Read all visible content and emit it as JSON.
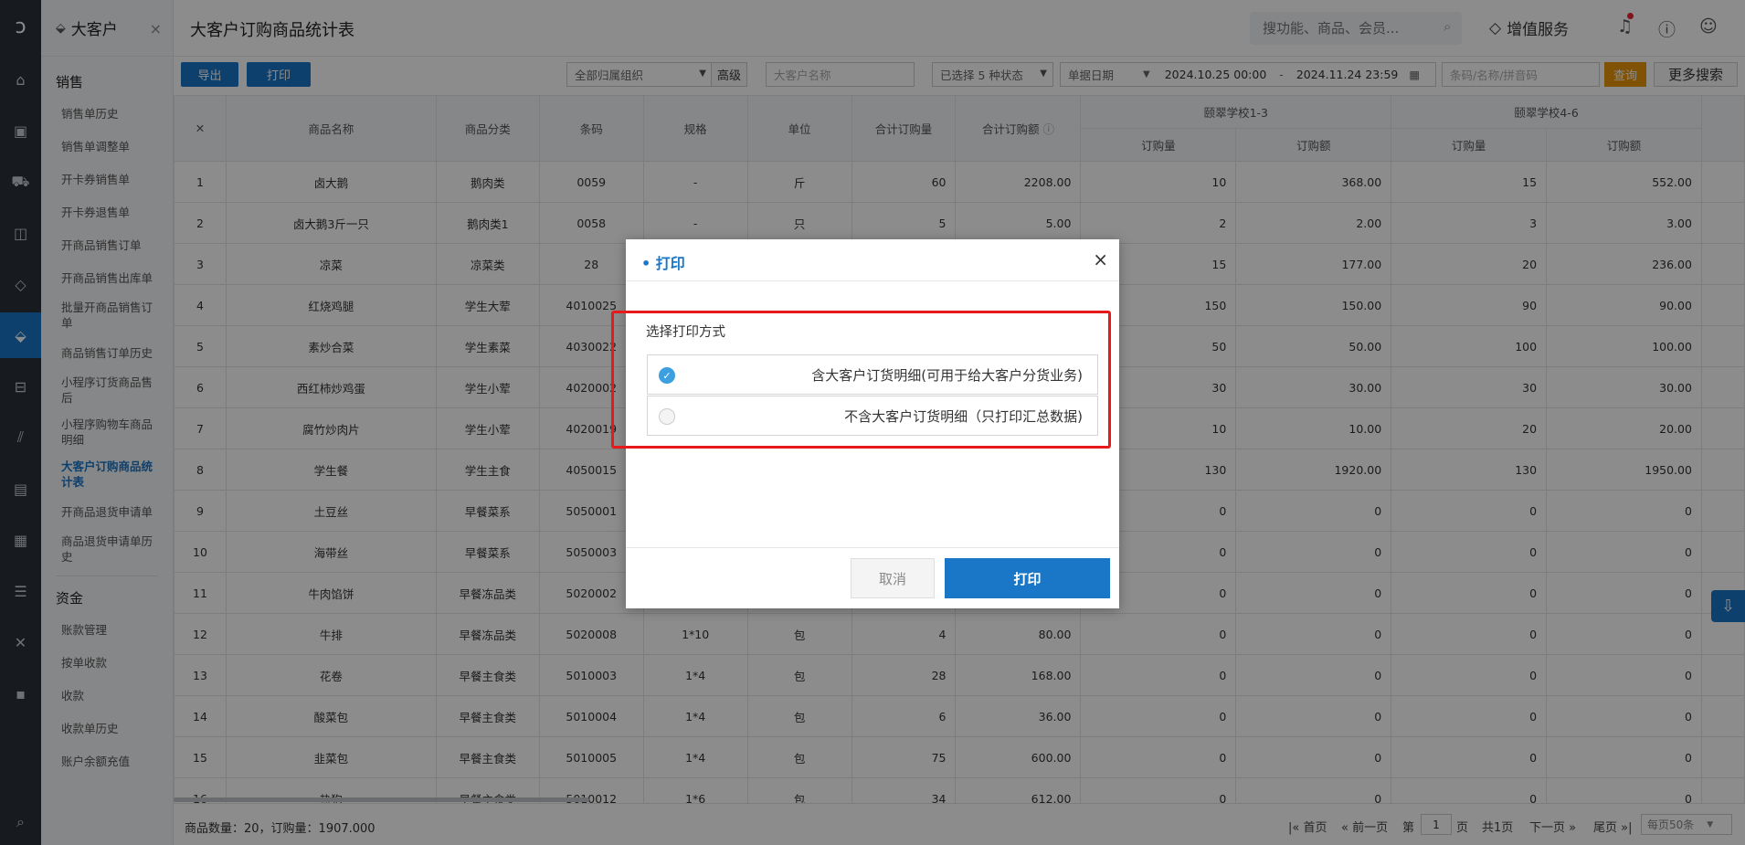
{
  "nav": {
    "title": "大客户",
    "close": "×",
    "sections": [
      {
        "name": "销售",
        "items": [
          "销售单历史",
          "销售单调整单",
          "开卡券销售单",
          "开卡券退售单",
          "开商品销售订单",
          "开商品销售出库单",
          "批量开商品销售订单",
          "商品销售订单历史",
          "小程序订货商品售后",
          "小程序购物车商品明细",
          "大客户订购商品统计表",
          "开商品退货申请单",
          "商品退货申请单历史"
        ]
      },
      {
        "name": "资金",
        "items": [
          "账款管理",
          "按单收款",
          "收款",
          "收款单历史",
          "账户余额充值"
        ]
      }
    ],
    "current": "大客户订购商品统计表"
  },
  "header": {
    "title": "大客户订购商品统计表",
    "search_placeholder": "搜功能、商品、会员...",
    "value_service": "增值服务"
  },
  "toolbar": {
    "export": "导出",
    "print": "打印",
    "org_select": "全部归属组织",
    "advanced": "高级",
    "customer_placeholder": "大客户名称",
    "status_select": "已选择 5 种状态",
    "date_type": "单据日期",
    "date_from": "2024.10.25 00:00",
    "date_sep": "-",
    "date_to": "2024.11.24 23:59",
    "code_placeholder": "条码/名称/拼音码",
    "query": "查询",
    "more": "更多搜索"
  },
  "table": {
    "headers": [
      "商品名称",
      "商品分类",
      "条码",
      "规格",
      "单位",
      "合计订购量",
      "合计订购额"
    ],
    "groups": [
      "颐翠学校1-3",
      "颐翠学校4-6"
    ],
    "sub_headers": [
      "订购量",
      "订购额"
    ],
    "rows": [
      [
        "1",
        "卤大鹅",
        "鹅肉类",
        "0059",
        "-",
        "斤",
        "60",
        "2208.00",
        "10",
        "368.00",
        "15",
        "552.00"
      ],
      [
        "2",
        "卤大鹅3斤一只",
        "鹅肉类1",
        "0058",
        "-",
        "只",
        "5",
        "5.00",
        "2",
        "2.00",
        "3",
        "3.00"
      ],
      [
        "3",
        "凉菜",
        "凉菜类",
        "28",
        "",
        "",
        "",
        "",
        "15",
        "177.00",
        "20",
        "236.00"
      ],
      [
        "4",
        "红烧鸡腿",
        "学生大荤",
        "4010025",
        "",
        "",
        "",
        "",
        "150",
        "150.00",
        "90",
        "90.00"
      ],
      [
        "5",
        "素炒合菜",
        "学生素菜",
        "4030022",
        "",
        "",
        "",
        "",
        "50",
        "50.00",
        "100",
        "100.00"
      ],
      [
        "6",
        "西红柿炒鸡蛋",
        "学生小荤",
        "4020002",
        "",
        "",
        "",
        "",
        "30",
        "30.00",
        "30",
        "30.00"
      ],
      [
        "7",
        "腐竹炒肉片",
        "学生小荤",
        "4020019",
        "",
        "",
        "",
        "",
        "10",
        "10.00",
        "20",
        "20.00"
      ],
      [
        "8",
        "学生餐",
        "学生主食",
        "4050015",
        "",
        "",
        "",
        "",
        "130",
        "1920.00",
        "130",
        "1950.00"
      ],
      [
        "9",
        "土豆丝",
        "早餐菜系",
        "5050001",
        "",
        "",
        "",
        "",
        "0",
        "0",
        "0",
        "0"
      ],
      [
        "10",
        "海带丝",
        "早餐菜系",
        "5050003",
        "",
        "",
        "",
        "",
        "0",
        "0",
        "0",
        "0"
      ],
      [
        "11",
        "牛肉馅饼",
        "早餐冻品类",
        "5020002",
        "",
        "",
        "",
        "",
        "0",
        "0",
        "0",
        "0"
      ],
      [
        "12",
        "牛排",
        "早餐冻品类",
        "5020008",
        "1*10",
        "包",
        "4",
        "80.00",
        "0",
        "0",
        "0",
        "0"
      ],
      [
        "13",
        "花卷",
        "早餐主食类",
        "5010003",
        "1*4",
        "包",
        "28",
        "168.00",
        "0",
        "0",
        "0",
        "0"
      ],
      [
        "14",
        "酸菜包",
        "早餐主食类",
        "5010004",
        "1*4",
        "包",
        "6",
        "36.00",
        "0",
        "0",
        "0",
        "0"
      ],
      [
        "15",
        "韭菜包",
        "早餐主食类",
        "5010005",
        "1*4",
        "包",
        "75",
        "600.00",
        "0",
        "0",
        "0",
        "0"
      ],
      [
        "16",
        "热狗",
        "早餐主食类",
        "5010012",
        "1*6",
        "包",
        "34",
        "612.00",
        "0",
        "0",
        "0",
        "0"
      ]
    ]
  },
  "footer": {
    "summary": "商品数量：20，订购量：1907.000",
    "first": "首页",
    "prev": "前一页",
    "page_prefix": "第",
    "page": "1",
    "page_suffix": "页",
    "total": "共1页",
    "next": "下一页",
    "last": "尾页",
    "per_page": "每页50条"
  },
  "dialog": {
    "title": "打印",
    "close": "×",
    "label": "选择打印方式",
    "options": [
      "含大客户订货明细(可用于给大客户分货业务)",
      "不含大客户订货明细（只打印汇总数据)"
    ],
    "selected": 0,
    "cancel": "取消",
    "ok": "打印"
  },
  "colors": {
    "primary": "#1a76c6",
    "highlight": "#e8191b",
    "orange": "#e8950c"
  }
}
